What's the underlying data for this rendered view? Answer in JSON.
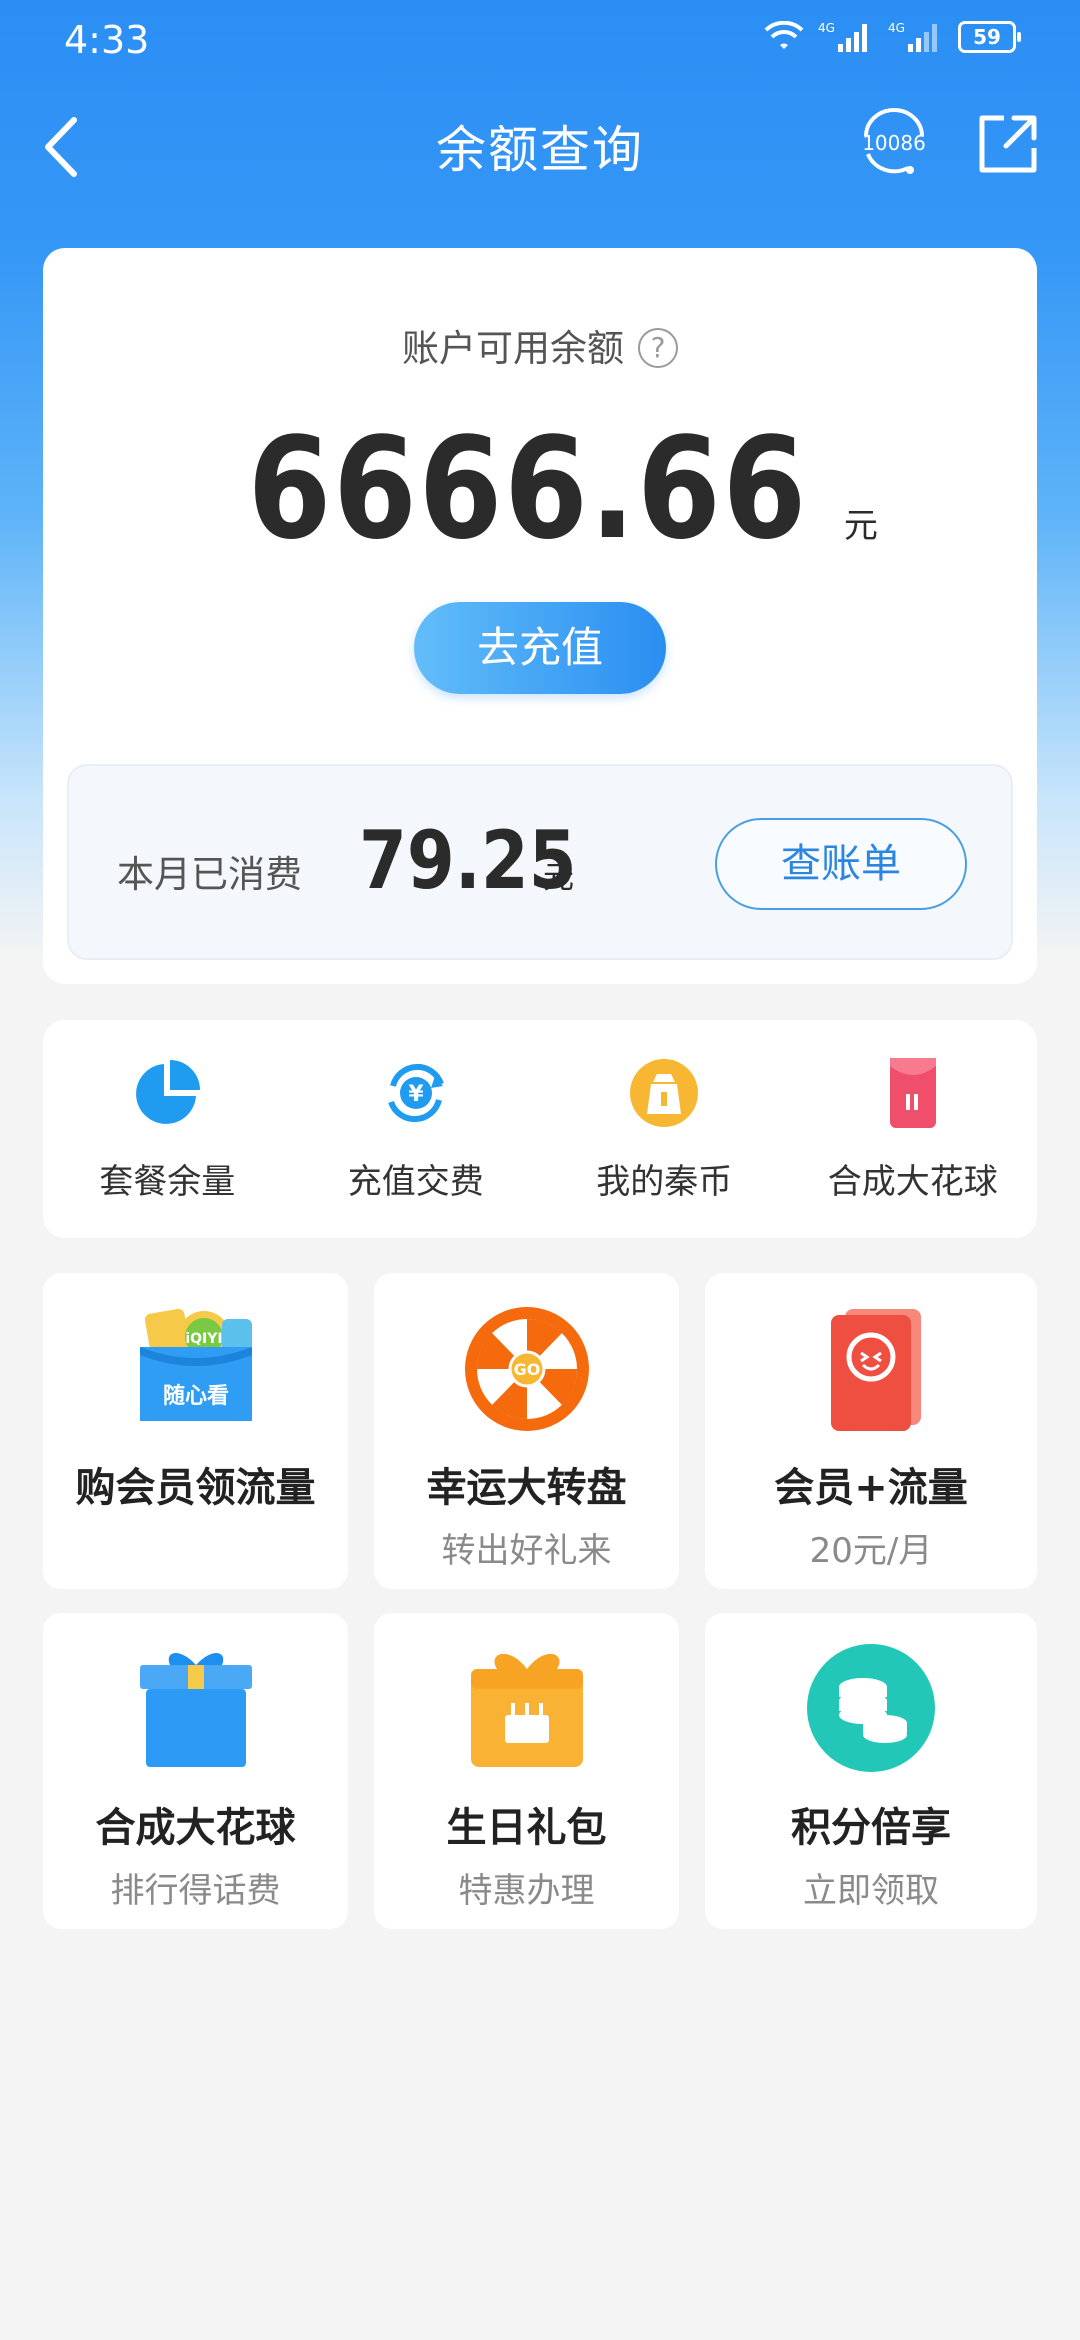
{
  "status_bar": {
    "time": "4:33",
    "network_1": "4G",
    "network_2": "4G",
    "battery": "59"
  },
  "nav": {
    "title": "余额查询",
    "service_number": "10086",
    "back_icon": "chevron-left-icon",
    "share_icon": "share-icon"
  },
  "balance": {
    "label": "账户可用余额",
    "help": "?",
    "amount": "6666.66",
    "unit": "元",
    "recharge_label": "去充值"
  },
  "spend": {
    "label": "本月已消费",
    "amount": "79.25",
    "unit": "元",
    "bill_label": "查账单"
  },
  "quick_actions": [
    {
      "label": "套餐余量",
      "icon": "pie-chart-icon"
    },
    {
      "label": "充值交费",
      "icon": "yuan-refresh-icon"
    },
    {
      "label": "我的秦币",
      "icon": "coin-bag-icon"
    },
    {
      "label": "合成大花球",
      "icon": "red-envelope-icon"
    }
  ],
  "tiles": [
    {
      "title": "购会员领流量",
      "subtitle": "",
      "icon": "membership-cards-icon",
      "badge": "随心看"
    },
    {
      "title": "幸运大转盘",
      "subtitle": "转出好礼来",
      "icon": "lucky-wheel-icon",
      "badge": "GO"
    },
    {
      "title": "会员+流量",
      "subtitle": "20元/月",
      "icon": "member-card-icon"
    },
    {
      "title": "合成大花球",
      "subtitle": "排行得话费",
      "icon": "gift-box-icon"
    },
    {
      "title": "生日礼包",
      "subtitle": "特惠办理",
      "icon": "birthday-gift-icon"
    },
    {
      "title": "积分倍享",
      "subtitle": "立即领取",
      "icon": "coins-stack-icon"
    }
  ],
  "colors": {
    "header_blue": "#2b8ef4",
    "accent_blue": "#2a86e0",
    "background": "#f4f4f4"
  }
}
